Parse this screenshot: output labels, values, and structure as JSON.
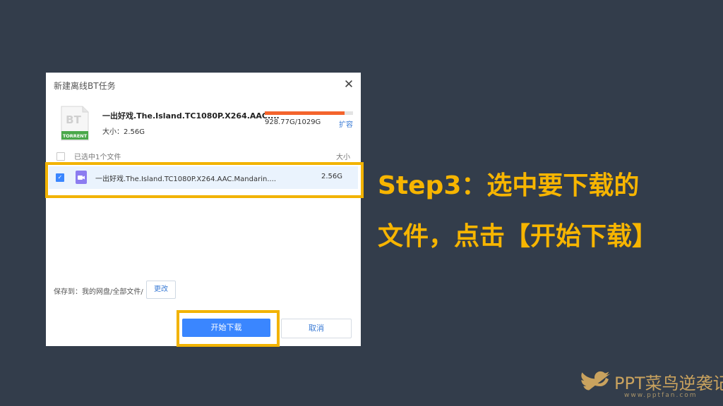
{
  "dialog": {
    "title": "新建离线BT任务",
    "bt_icon_text": "BT",
    "torrent_label": "TORRENT",
    "file_name": "一出好戏.The.Island.TC1080P.X264.AAC....",
    "file_size": "大小：2.56G",
    "quota": {
      "text": "928.77G/1029G",
      "used_fraction": 0.9026
    },
    "expand_label": "扩容",
    "list_header": {
      "selected_label": "已选中1个文件",
      "size_label": "大小"
    },
    "files": [
      {
        "name": "一出好戏.The.Island.TC1080P.X264.AAC.Mandarin....",
        "size": "2.56G",
        "checked": true
      }
    ],
    "save_to": "保存到：我的网盘/全部文件/",
    "change_label": "更改",
    "start_label": "开始下载",
    "cancel_label": "取消",
    "colors": {
      "primary": "#3a86ff",
      "quota": "#f4642d",
      "torrent_green": "#4aa84a"
    }
  },
  "instruction": {
    "line1": "Step3：选中要下载的",
    "line2": "文件，点击【开始下载】",
    "color": "#f7b500"
  },
  "brand": {
    "name": "PPT菜鸟逆袭记",
    "url": "www.pptfan.com",
    "icon": "twitter-bird-icon"
  }
}
